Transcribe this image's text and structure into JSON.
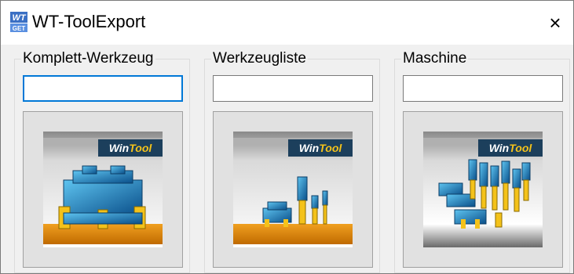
{
  "window": {
    "title": "WT-ToolExport",
    "close_glyph": "×",
    "icon": "wt-get-app-icon"
  },
  "groups": [
    {
      "label": "Komplett-Werkzeug",
      "input_value": "",
      "focused": true,
      "image": "complete-tool-image",
      "badge": {
        "a": "Win",
        "b": "Tool"
      }
    },
    {
      "label": "Werkzeugliste",
      "input_value": "",
      "focused": false,
      "image": "tool-list-image",
      "badge": {
        "a": "Win",
        "b": "Tool"
      }
    },
    {
      "label": "Maschine",
      "input_value": "",
      "focused": false,
      "image": "machine-image",
      "badge": {
        "a": "Win",
        "b": "Tool"
      }
    }
  ],
  "colors": {
    "accent": "#0078d7",
    "tool_blue": "#1e8fc9",
    "tool_yellow": "#f4c21a",
    "floor_orange": "#e8900a",
    "badge_bg": "#1c3f5c"
  }
}
